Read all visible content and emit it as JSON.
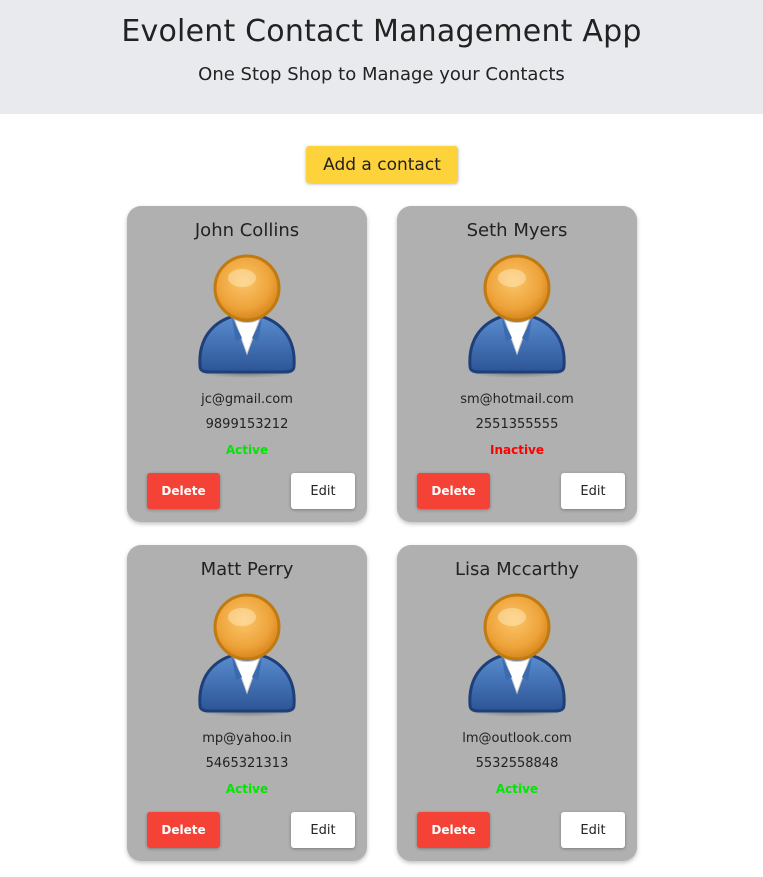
{
  "header": {
    "title": "Evolent Contact Management App",
    "subtitle": "One Stop Shop to Manage your Contacts"
  },
  "toolbar": {
    "add_label": "Add a contact"
  },
  "colors": {
    "header_bg": "#e8eaed",
    "accent": "#fdd23a",
    "card_bg": "#b0b0b0",
    "delete": "#f44336",
    "active": "#00e600",
    "inactive": "#ff0000"
  },
  "contacts": [
    {
      "name": "John Collins",
      "email": "jc@gmail.com",
      "phone": "9899153212",
      "status": "Active",
      "delete_label": "Delete",
      "edit_label": "Edit",
      "avatar_icon": "user-avatar-icon"
    },
    {
      "name": "Seth Myers",
      "email": "sm@hotmail.com",
      "phone": "2551355555",
      "status": "Inactive",
      "delete_label": "Delete",
      "edit_label": "Edit",
      "avatar_icon": "user-avatar-icon"
    },
    {
      "name": "Matt Perry",
      "email": "mp@yahoo.in",
      "phone": "5465321313",
      "status": "Active",
      "delete_label": "Delete",
      "edit_label": "Edit",
      "avatar_icon": "user-avatar-icon"
    },
    {
      "name": "Lisa Mccarthy",
      "email": "lm@outlook.com",
      "phone": "5532558848",
      "status": "Active",
      "delete_label": "Delete",
      "edit_label": "Edit",
      "avatar_icon": "user-avatar-icon"
    }
  ]
}
